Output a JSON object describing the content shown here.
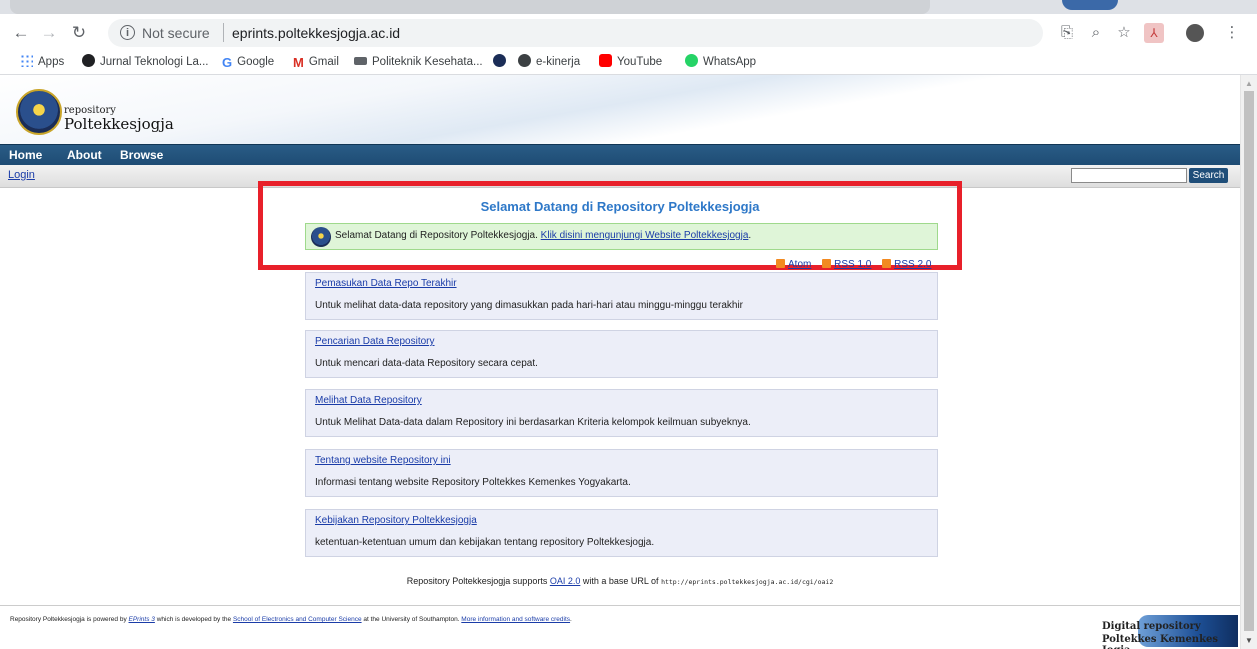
{
  "browser": {
    "url_security": "Not secure",
    "url": "eprints.poltekkesjogja.ac.id",
    "nav": {
      "back_icon": "arrow-left-icon",
      "forward_icon": "arrow-right-icon",
      "reload_icon": "reload-icon"
    },
    "bookmarks": [
      {
        "label": "Apps",
        "color": "#4285f4"
      },
      {
        "label": "Jurnal Teknologi La...",
        "color": "#202124"
      },
      {
        "label": "Google",
        "color": "#4285f4"
      },
      {
        "label": "Gmail",
        "color": "#d93025"
      },
      {
        "label": "Politeknik Kesehata...",
        "color": "#5f6368"
      },
      {
        "label": "",
        "color": "#1b2d57"
      },
      {
        "label": "e-kinerja",
        "color": "#3c4043"
      },
      {
        "label": "YouTube",
        "color": "#ff0000"
      },
      {
        "label": "WhatsApp",
        "color": "#25d366"
      }
    ]
  },
  "site": {
    "logo_small": "repository",
    "logo_big": "Poltekkesjogja",
    "menu": [
      "Home",
      "About",
      "Browse"
    ],
    "login": "Login",
    "search_button": "Search",
    "title": "Selamat Datang di Repository Poltekkesjogja",
    "welcome_text": "Selamat Datang di Repository Poltekkesjogja.",
    "welcome_link": "Klik disini mengunjungi Website Poltekkesjogja",
    "welcome_end": ".",
    "feeds": [
      "Atom",
      "RSS 1.0",
      "RSS 2.0"
    ],
    "cards": [
      {
        "link": "Pemasukan Data Repo Terakhir",
        "desc": "Untuk melihat data-data repository yang dimasukkan pada hari-hari atau minggu-minggu terakhir"
      },
      {
        "link": "Pencarian Data Repository",
        "desc": "Untuk mencari data-data Repository secara cepat."
      },
      {
        "link": "Melihat Data Repository",
        "desc": "Untuk Melihat Data-data dalam Repository ini berdasarkan Kriteria kelompok keilmuan subyeknya."
      },
      {
        "link": "Tentang website Repository ini",
        "desc": "Informasi tentang website Repository Poltekkes Kemenkes Yogyakarta."
      },
      {
        "link": "Kebijakan Repository Poltekkesjogja",
        "desc": "ketentuan-ketentuan umum dan kebijakan tentang repository Poltekkesjogja."
      }
    ],
    "oai": {
      "prefix": "Repository Poltekkesjogja supports ",
      "link": "OAI 2.0",
      "middle": " with a base URL of ",
      "base_url": "http://eprints.poltekkesjogja.ac.id/cgi/oai2"
    },
    "footer": {
      "t1": "Repository Poltekkesjogja is powered by ",
      "eprints": "EPrints 3",
      "t2": " which is developed by the ",
      "school": "School of Electronics and Computer Science",
      "t3": " at the University of Southampton. ",
      "more": "More information and software credits",
      "t4": "."
    },
    "digital_logo": {
      "line1": "Digital repository",
      "line2": "Poltekkes Kemenkes Jogja"
    }
  }
}
